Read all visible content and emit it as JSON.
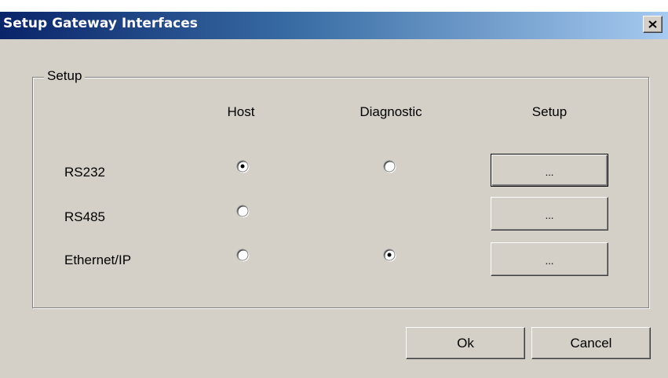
{
  "window": {
    "title": "Setup Gateway Interfaces",
    "close_glyph": "close-icon"
  },
  "group": {
    "label": "Setup"
  },
  "columns": {
    "host": "Host",
    "diagnostic": "Diagnostic",
    "setup": "Setup"
  },
  "rows": [
    {
      "label": "RS232",
      "host_selected": true,
      "diagnostic_selected": false,
      "has_diagnostic": true,
      "setup_label": "..."
    },
    {
      "label": "RS485",
      "host_selected": false,
      "diagnostic_selected": false,
      "has_diagnostic": false,
      "setup_label": "..."
    },
    {
      "label": "Ethernet/IP",
      "host_selected": false,
      "diagnostic_selected": true,
      "has_diagnostic": true,
      "setup_label": "..."
    }
  ],
  "buttons": {
    "ok": "Ok",
    "cancel": "Cancel"
  },
  "colors": {
    "title_gradient_start": "#0a246a",
    "title_gradient_end": "#a6caf0",
    "face": "#d4d0c8"
  }
}
